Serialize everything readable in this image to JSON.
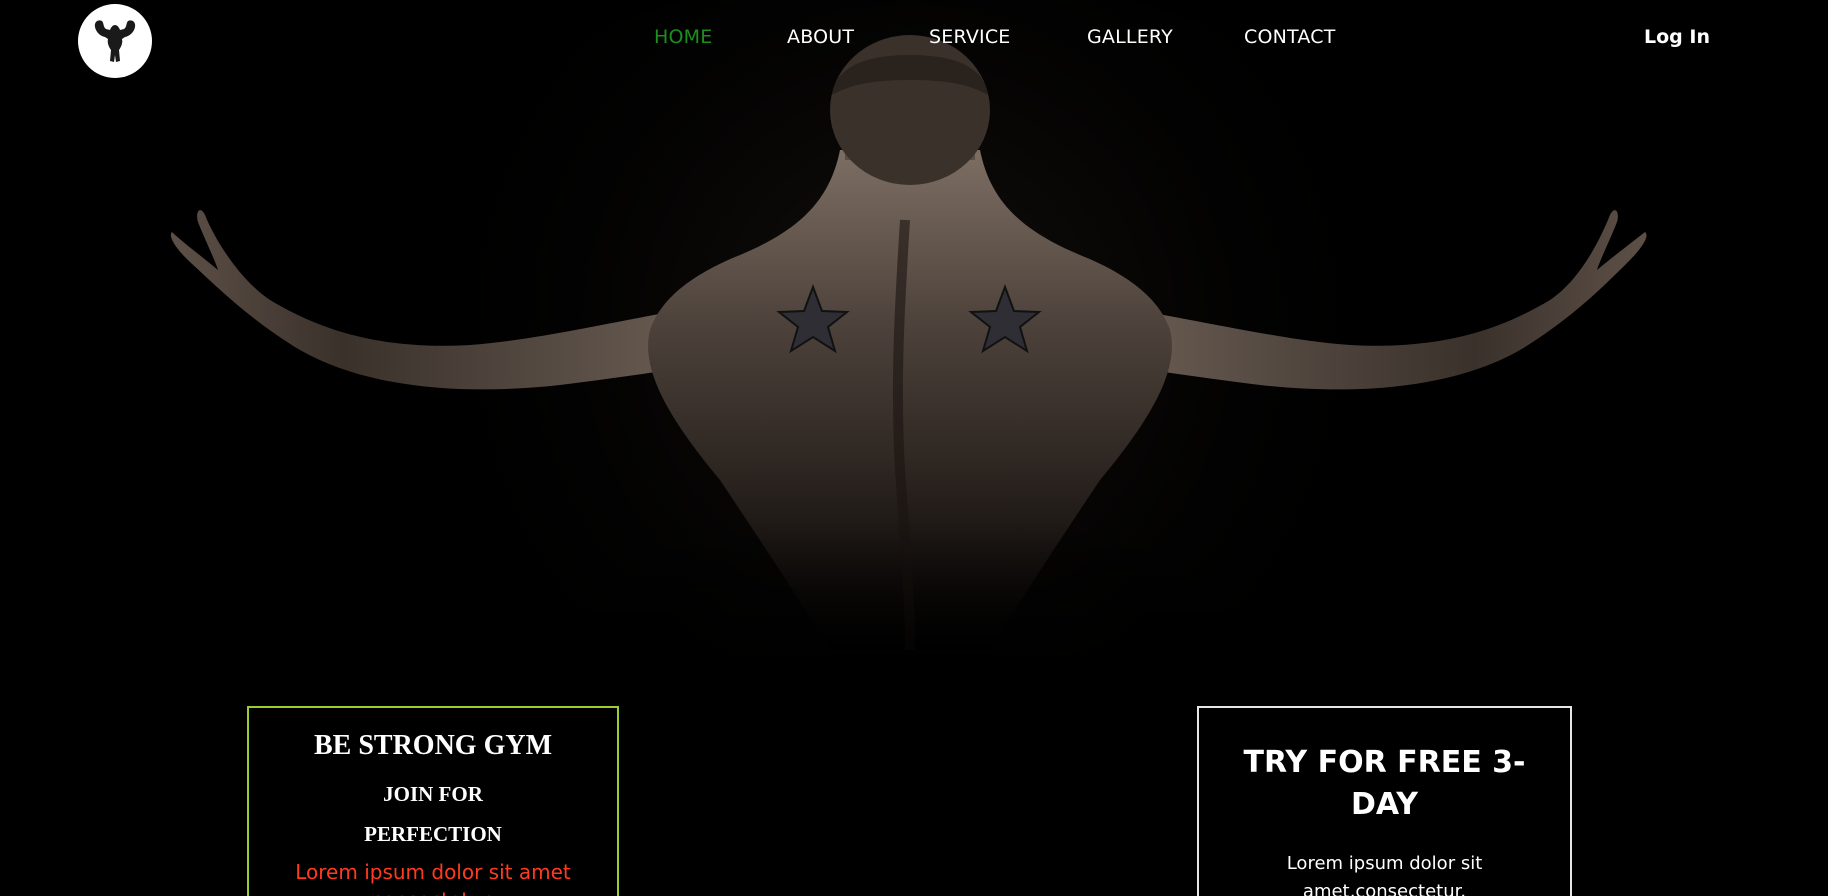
{
  "nav": {
    "links": [
      {
        "label": "HOME",
        "active": true
      },
      {
        "label": "ABOUT",
        "active": false
      },
      {
        "label": "SERVICE",
        "active": false
      },
      {
        "label": "GALLERY",
        "active": false
      },
      {
        "label": "CONTACT",
        "active": false
      }
    ],
    "login_label": "Log In",
    "active_color": "#1c8f1c",
    "text_color": "#ffffff"
  },
  "logo": {
    "icon": "flexing-bodybuilder-icon",
    "background": "#ffffff"
  },
  "hero": {
    "image": "muscular-back-arms-spread-photo",
    "background": "#000000"
  },
  "card_left": {
    "title": "BE STRONG GYM",
    "subtitle": "JOIN FOR PERFECTION",
    "text": "Lorem ipsum dolor sit amet consectetur.",
    "border_color": "#9acd32",
    "text_color": "#ff3b1f"
  },
  "card_right": {
    "title": "TRY FOR FREE 3-DAY",
    "text": "Lorem ipsum dolor sit amet,consectetur.",
    "border_color": "#e6e6e6"
  }
}
